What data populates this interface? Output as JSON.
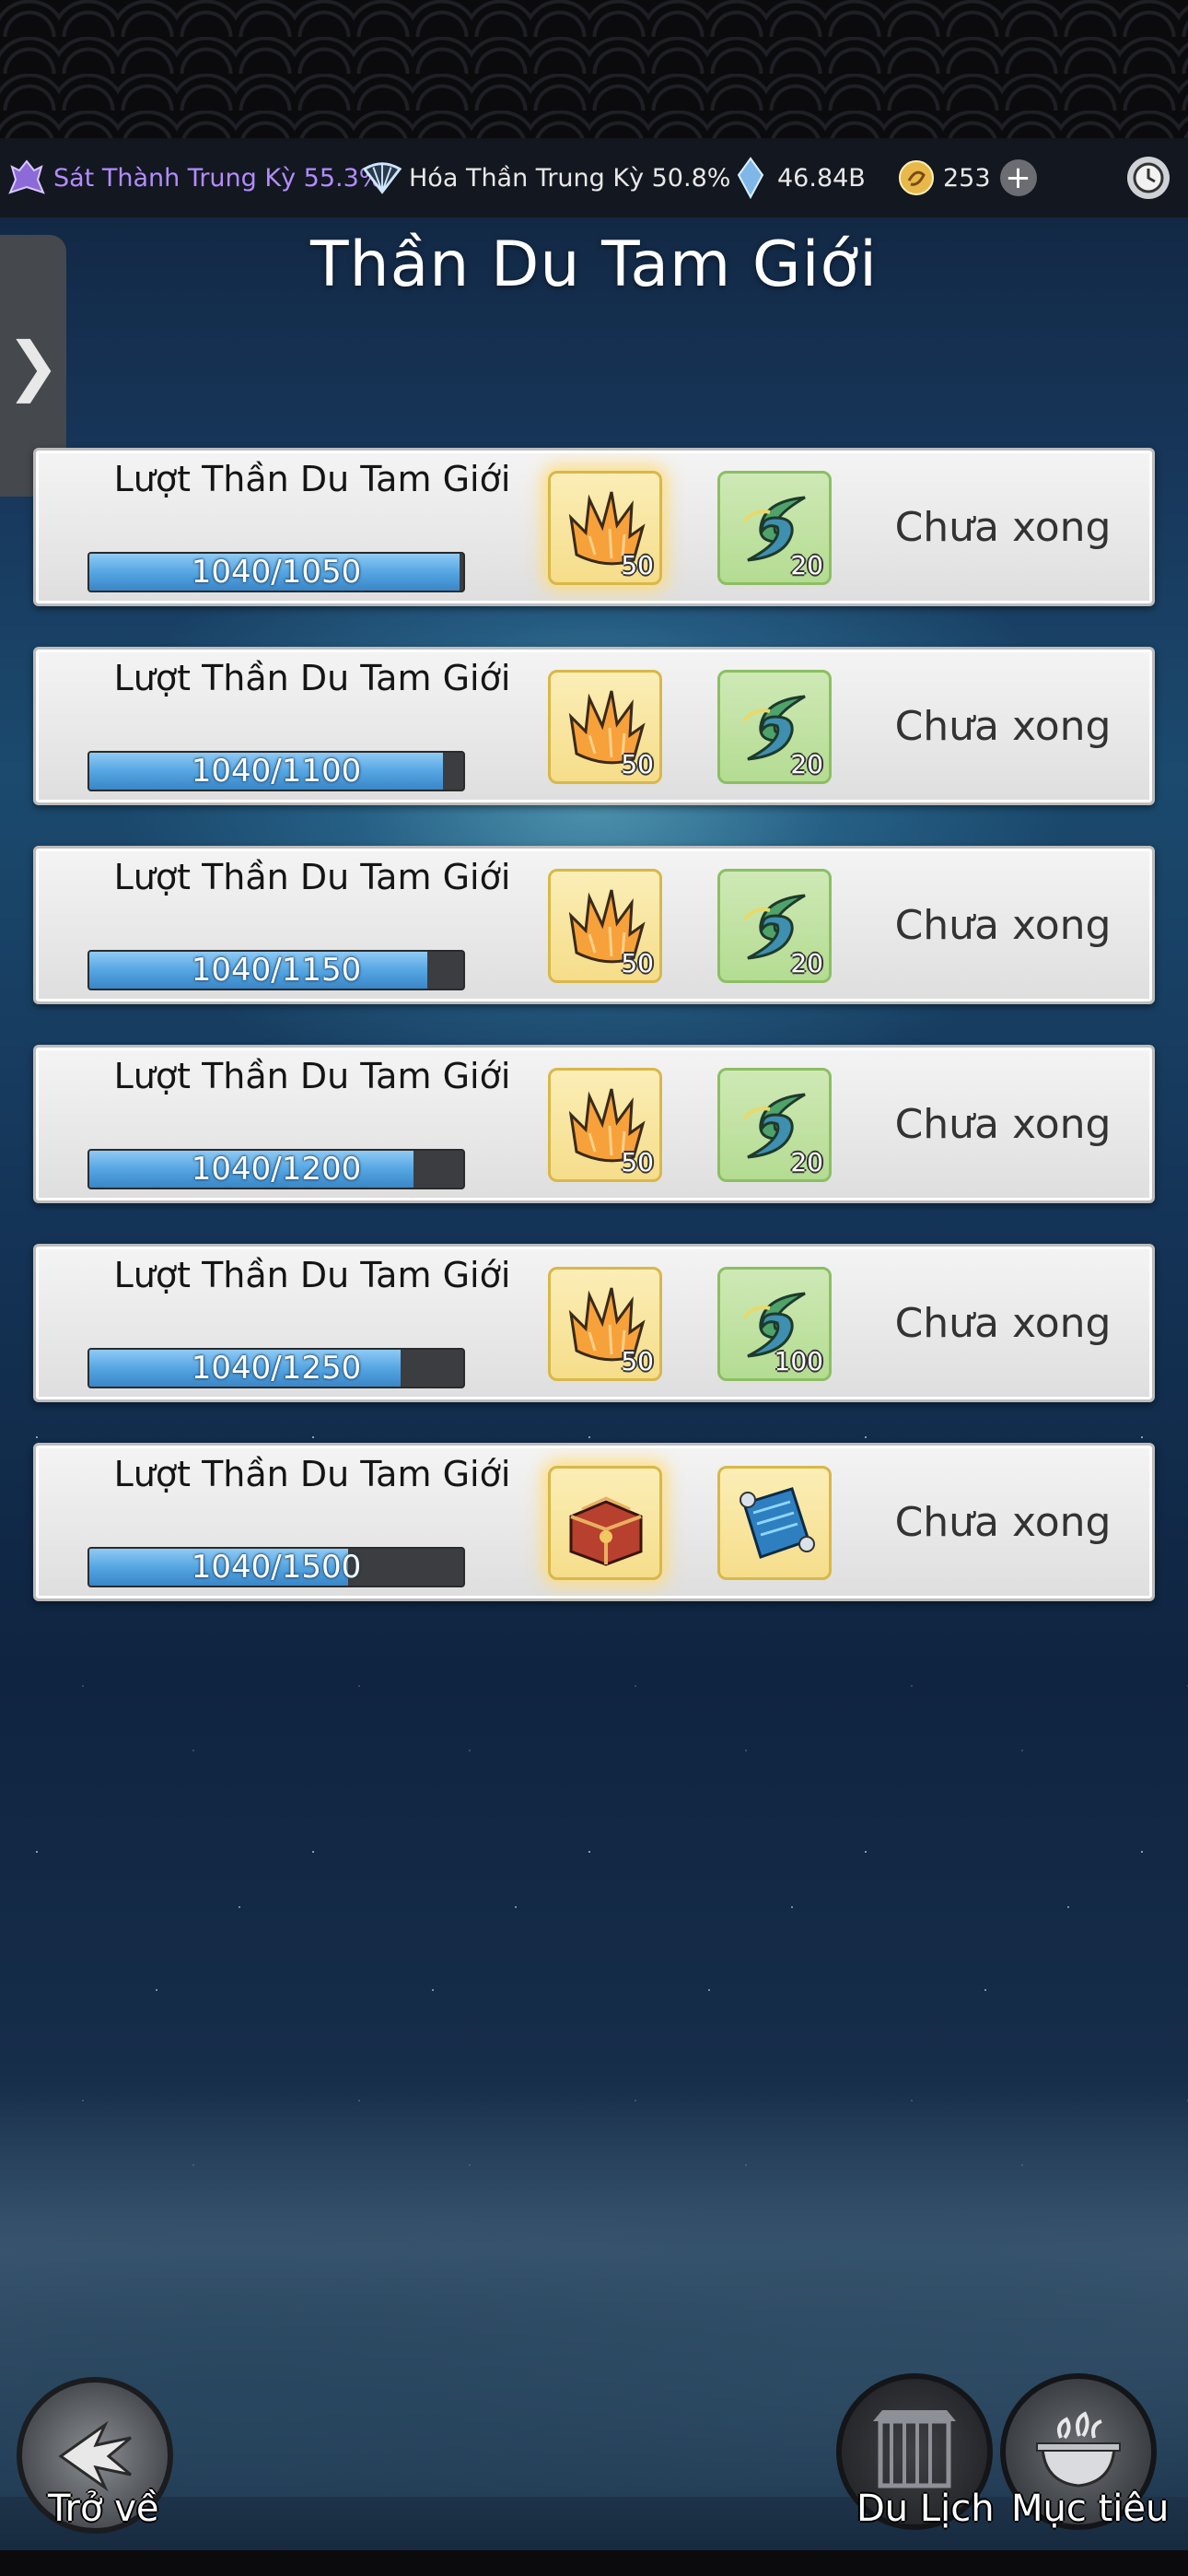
{
  "status_bar": {
    "stat1": {
      "icon": "purple-character-icon",
      "label": "Sát Thành Trung Kỳ 55.3%"
    },
    "stat2": {
      "icon": "fan-icon",
      "label": "Hóa Thần Trung Kỳ 50.8%"
    },
    "stat3": {
      "icon": "crystal-icon",
      "value": "46.84B"
    },
    "stat4": {
      "icon": "coin-icon",
      "value": "253"
    },
    "plus_label": "+"
  },
  "title": "Thần Du Tam Giới",
  "side_tab_glyph": "❯",
  "rows": [
    {
      "title": "Lượt Thần Du Tam Giới",
      "progress_text": "1040/1050",
      "progress": 0.99,
      "reward1": {
        "icon": "orange-crystal-icon",
        "qty": "50"
      },
      "reward2": {
        "icon": "green-swirl-icon",
        "qty": "20"
      },
      "status": "Chưa xong"
    },
    {
      "title": "Lượt Thần Du Tam Giới",
      "progress_text": "1040/1100",
      "progress": 0.945,
      "reward1": {
        "icon": "orange-crystal-icon",
        "qty": "50"
      },
      "reward2": {
        "icon": "green-swirl-icon",
        "qty": "20"
      },
      "status": "Chưa xong"
    },
    {
      "title": "Lượt Thần Du Tam Giới",
      "progress_text": "1040/1150",
      "progress": 0.904,
      "reward1": {
        "icon": "orange-crystal-icon",
        "qty": "50"
      },
      "reward2": {
        "icon": "green-swirl-icon",
        "qty": "20"
      },
      "status": "Chưa xong"
    },
    {
      "title": "Lượt Thần Du Tam Giới",
      "progress_text": "1040/1200",
      "progress": 0.867,
      "reward1": {
        "icon": "orange-crystal-icon",
        "qty": "50"
      },
      "reward2": {
        "icon": "green-swirl-icon",
        "qty": "20"
      },
      "status": "Chưa xong"
    },
    {
      "title": "Lượt Thần Du Tam Giới",
      "progress_text": "1040/1250",
      "progress": 0.832,
      "reward1": {
        "icon": "orange-crystal-icon",
        "qty": "50"
      },
      "reward2": {
        "icon": "green-swirl-icon",
        "qty": "100"
      },
      "status": "Chưa xong"
    },
    {
      "title": "Lượt Thần Du Tam Giới",
      "progress_text": "1040/1500",
      "progress": 0.693,
      "reward1": {
        "icon": "red-chest-icon",
        "qty": ""
      },
      "reward2": {
        "icon": "blue-scroll-icon",
        "qty": ""
      },
      "status": "Chưa xong"
    }
  ],
  "bottom": {
    "back_label": "Trở về",
    "travel_label": "Du Lịch",
    "goal_label": "Mục tiêu"
  }
}
